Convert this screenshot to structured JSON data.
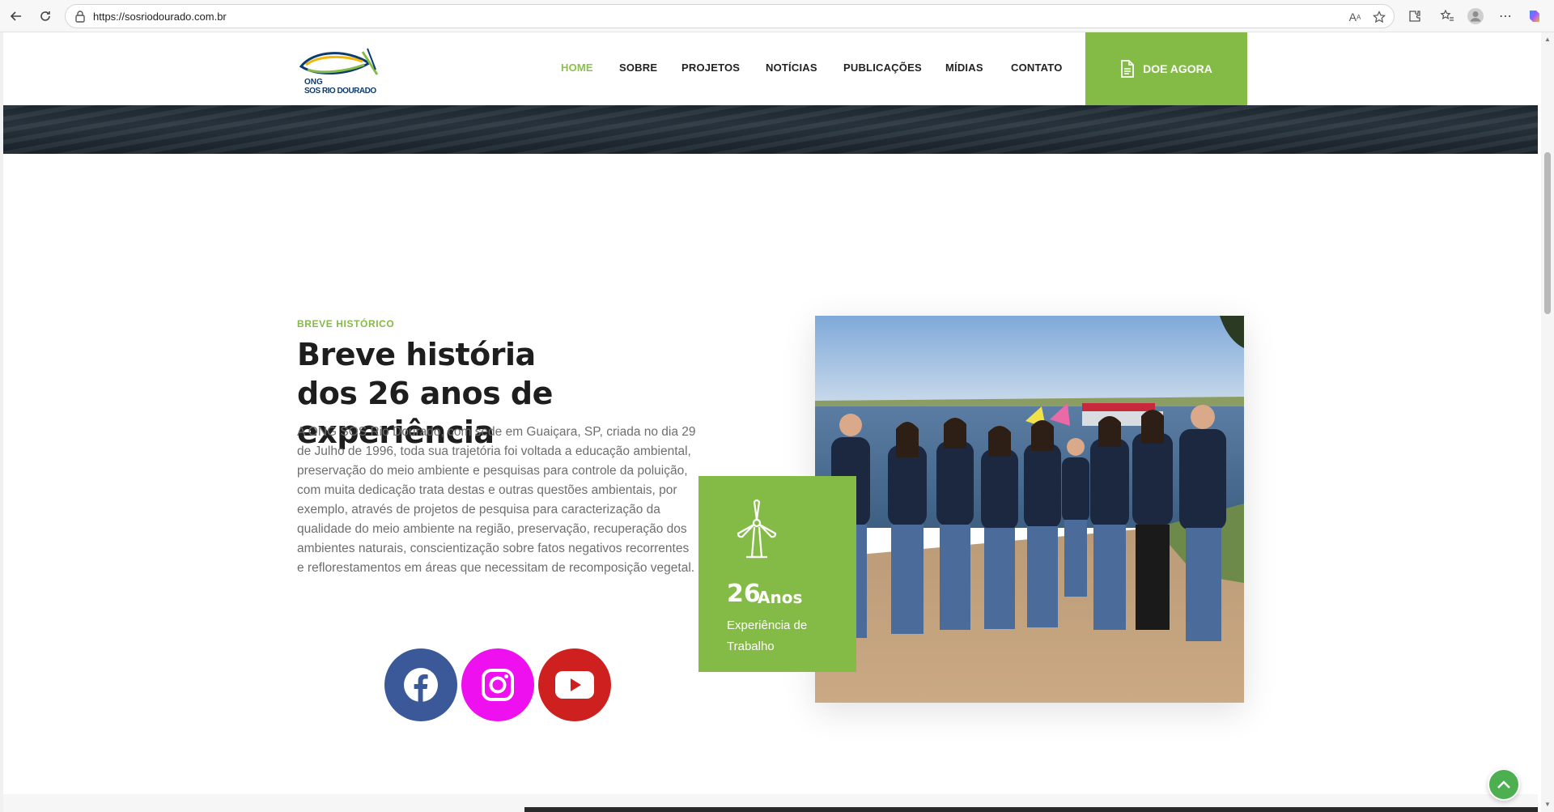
{
  "browser": {
    "url": "https://sosriodourado.com.br"
  },
  "logo": {
    "line1": "ONG",
    "line2": "SOS RIO DOURADO"
  },
  "menu": [
    {
      "label": "HOME",
      "active": true
    },
    {
      "label": "SOBRE"
    },
    {
      "label": "PROJETOS"
    },
    {
      "label": "NOTÍCIAS"
    },
    {
      "label": "PUBLICAÇÕES"
    },
    {
      "label": "MÍDIAS"
    },
    {
      "label": "CONTATO"
    }
  ],
  "donate": {
    "label": "DOE AGORA"
  },
  "history": {
    "eyebrow": "BREVE HISTÓRICO",
    "heading_line1": "Breve história",
    "heading_line2": "dos 26 anos de experiência",
    "body": "A ONG SOS Rio Dourado, com sede em Guaiçara, SP, criada no dia 29 de Julho de 1996, toda sua trajetória foi voltada a educação ambiental, preservação do meio ambiente e pesquisas para controle da poluição, com muita dedicação trata destas e outras questões ambientais, por exemplo, através de projetos de pesquisa para caracterização da qualidade do meio ambiente na região, preservação, recuperação dos ambientes naturais, conscientização sobre fatos negativos recorrentes e reflorestamentos em áreas que necessitam de recomposição vegetal."
  },
  "experience": {
    "number": "26",
    "unit": "Anos",
    "desc": "Experiência de Trabalho"
  },
  "colors": {
    "accent": "#84bb46",
    "facebook": "#3b5998",
    "instagram": "#ee10ef",
    "youtube": "#cd201f"
  }
}
